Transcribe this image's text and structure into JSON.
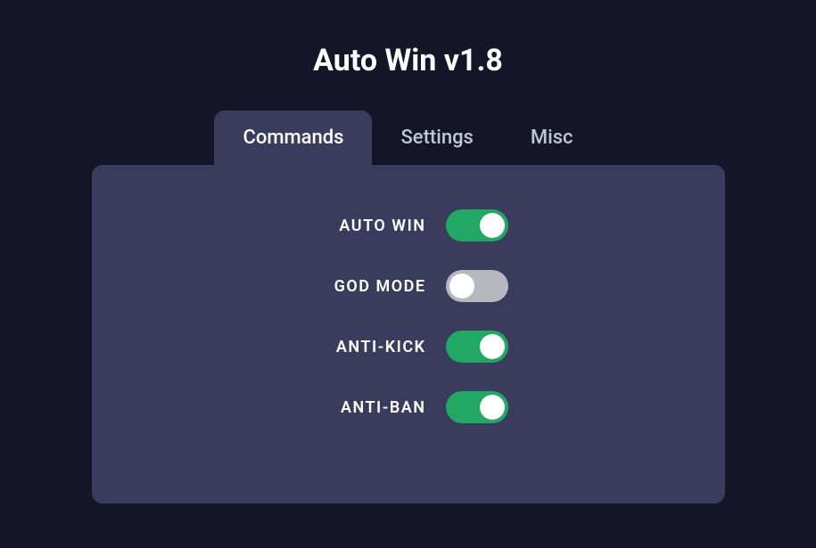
{
  "title": "Auto Win v1.8",
  "tabs": [
    {
      "label": "Commands",
      "active": true
    },
    {
      "label": "Settings",
      "active": false
    },
    {
      "label": "Misc",
      "active": false
    }
  ],
  "toggles": [
    {
      "label": "AUTO WIN",
      "state": "on"
    },
    {
      "label": "GOD MODE",
      "state": "off"
    },
    {
      "label": "ANTI-KICK",
      "state": "on"
    },
    {
      "label": "ANTI-BAN",
      "state": "on"
    }
  ],
  "colors": {
    "background": "#141627",
    "panel": "#3a3c5e",
    "toggle_on": "#22a864",
    "toggle_off": "#b6b8bf",
    "text": "#ffffff",
    "tab_inactive_text": "#c3c6d4"
  }
}
